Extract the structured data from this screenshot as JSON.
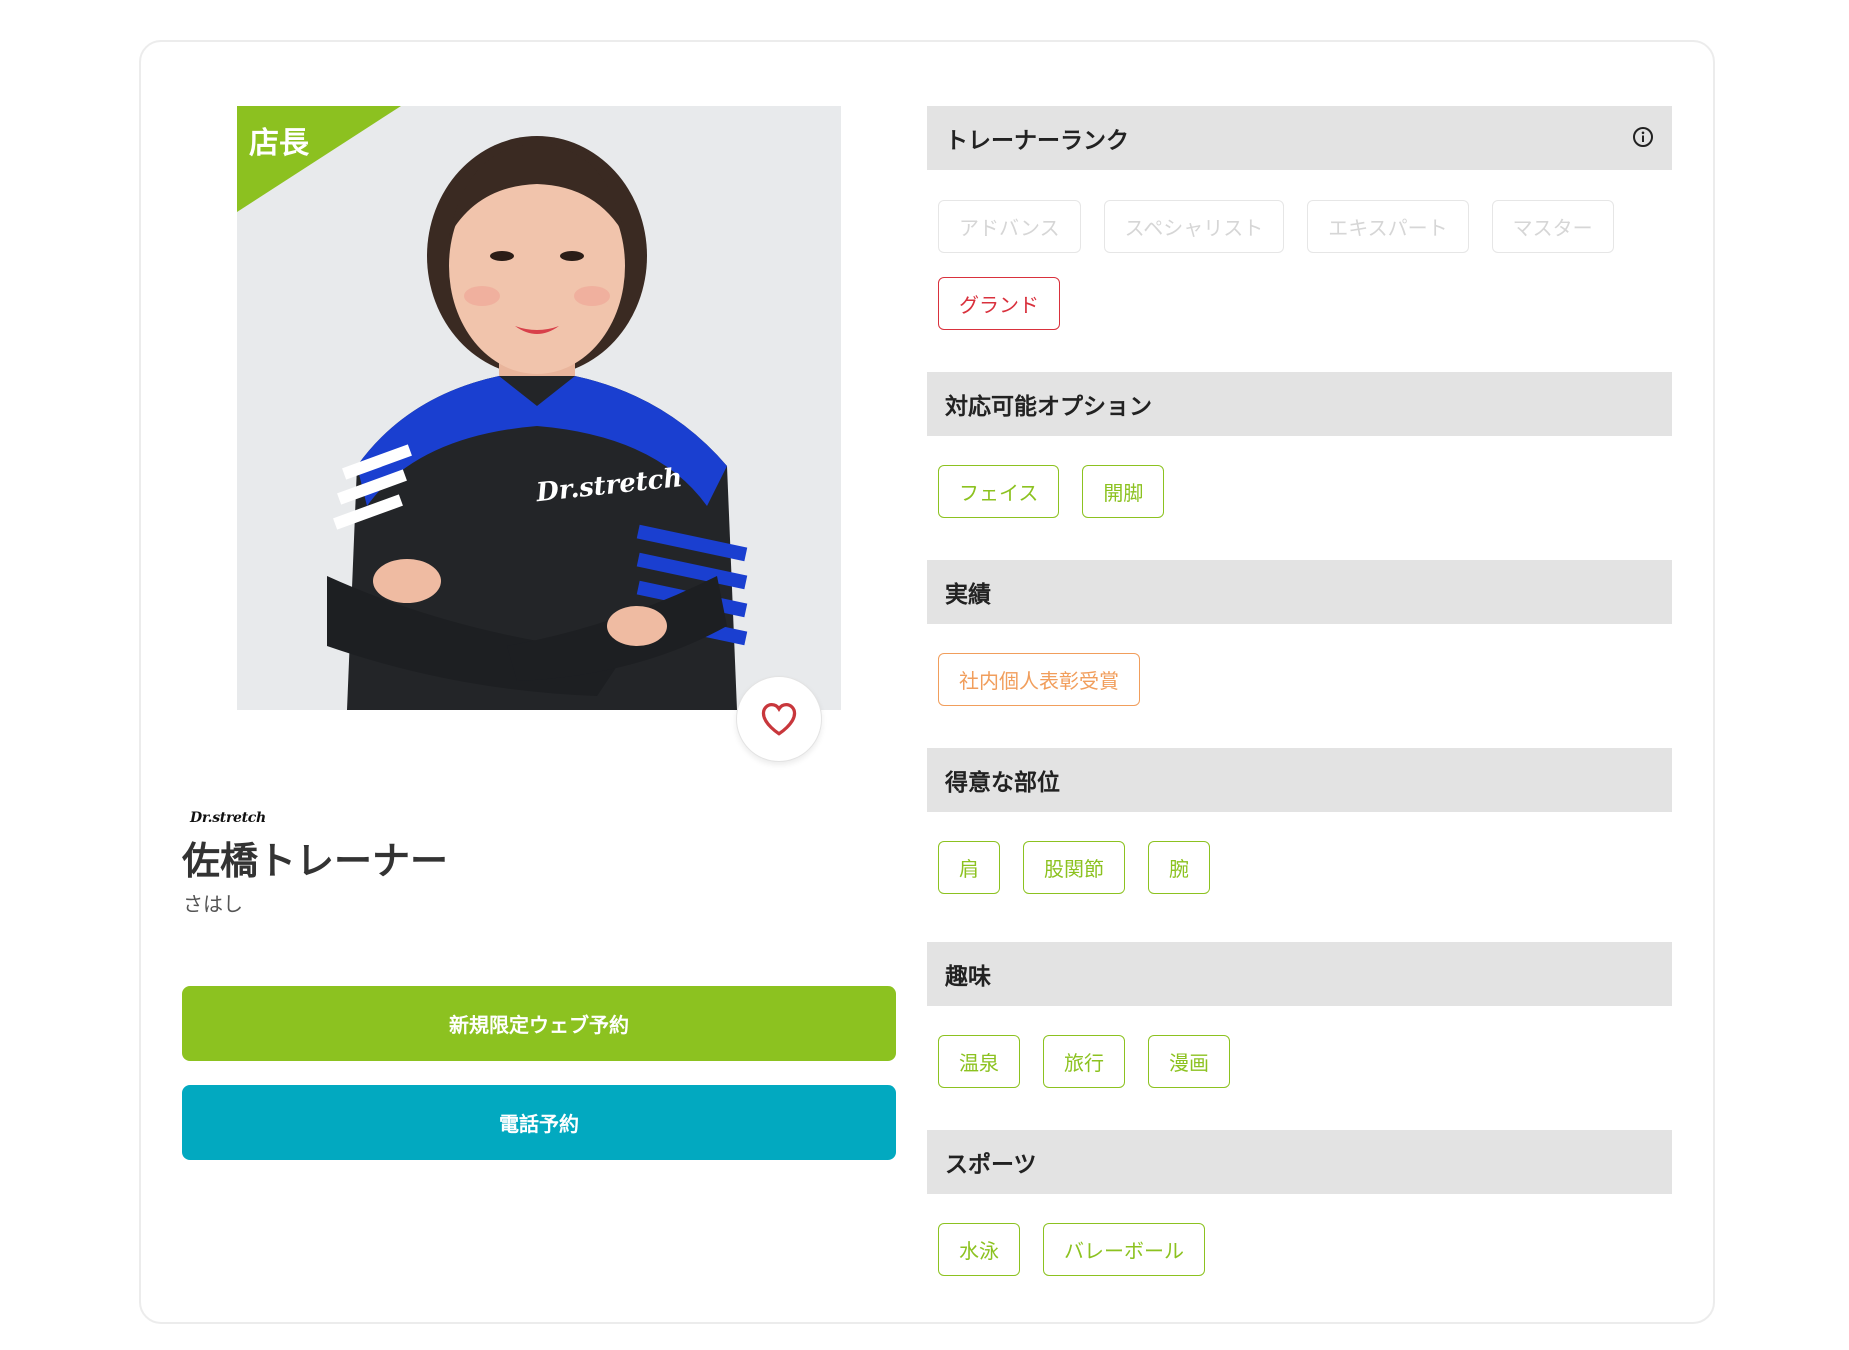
{
  "trainer": {
    "badge": "店長",
    "brand": "Dr.stretch",
    "name": "佐橋トレーナー",
    "kana": "さはし"
  },
  "actions": {
    "web_reserve": "新規限定ウェブ予約",
    "tel_reserve": "電話予約"
  },
  "sections": [
    {
      "title": "トレーナーランク",
      "tags": [
        {
          "label": "アドバンス",
          "state": "inactive"
        },
        {
          "label": "スペシャリスト",
          "state": "inactive"
        },
        {
          "label": "エキスパート",
          "state": "inactive"
        },
        {
          "label": "マスター",
          "state": "inactive"
        },
        {
          "label": "グランド",
          "state": "active"
        }
      ]
    },
    {
      "title": "対応可能オプション",
      "tags": [
        {
          "label": "フェイス"
        },
        {
          "label": "開脚"
        }
      ]
    },
    {
      "title": "実績",
      "tags": [
        {
          "label": "社内個人表彰受賞"
        }
      ]
    },
    {
      "title": "得意な部位",
      "tags": [
        {
          "label": "肩"
        },
        {
          "label": "股関節"
        },
        {
          "label": "腕"
        }
      ]
    },
    {
      "title": "趣味",
      "tags": [
        {
          "label": "温泉"
        },
        {
          "label": "旅行"
        },
        {
          "label": "漫画"
        }
      ]
    },
    {
      "title": "スポーツ",
      "tags": [
        {
          "label": "水泳"
        },
        {
          "label": "バレーボール"
        }
      ]
    }
  ],
  "colors": {
    "brand_green": "#8cc220",
    "tel_blue": "#02a9c0",
    "rank_active_red": "#d9313d",
    "achievement_orange": "#f19e5c",
    "section_header_bg": "#e3e3e3"
  },
  "icons": {
    "favorite": "heart-outline-icon",
    "rank_info": "info-circle-icon"
  }
}
